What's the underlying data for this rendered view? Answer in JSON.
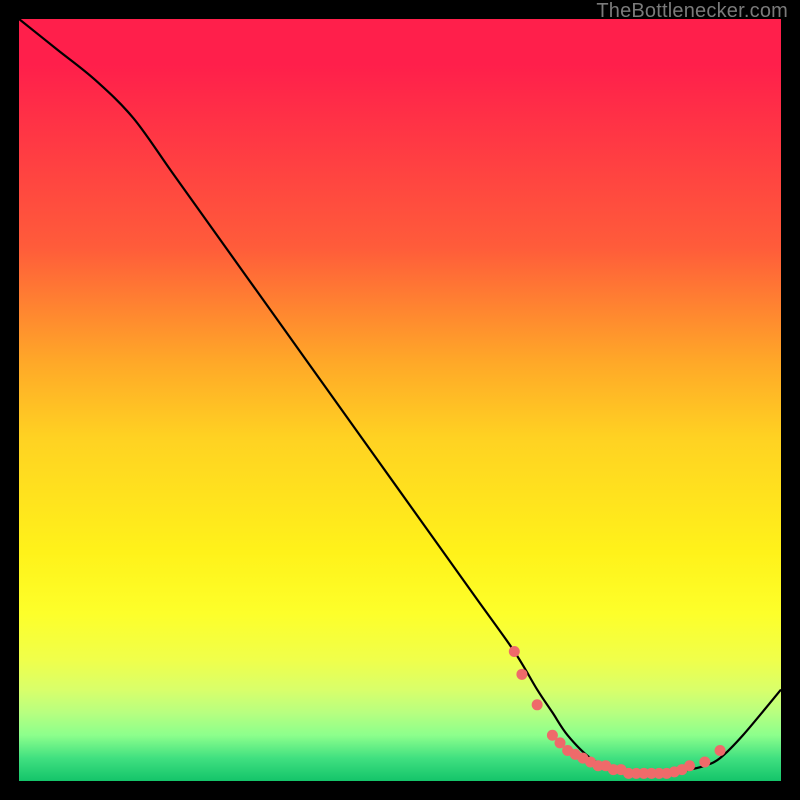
{
  "attribution": "TheBottlenecker.com",
  "chart_data": {
    "type": "line",
    "title": "",
    "xlabel": "",
    "ylabel": "",
    "xlim": [
      0,
      100
    ],
    "ylim": [
      0,
      100
    ],
    "series": [
      {
        "name": "bottleneck-curve",
        "x": [
          0,
          5,
          10,
          15,
          20,
          25,
          30,
          35,
          40,
          45,
          50,
          55,
          60,
          65,
          68,
          70,
          72,
          75,
          78,
          80,
          82,
          85,
          88,
          90,
          92,
          95,
          100
        ],
        "y": [
          100,
          96,
          92,
          87,
          80,
          73,
          66,
          59,
          52,
          45,
          38,
          31,
          24,
          17,
          12,
          9,
          6,
          3,
          1.5,
          1,
          1,
          1,
          1.5,
          2,
          3,
          6,
          12
        ]
      }
    ],
    "markers": {
      "name": "scatter-points",
      "color": "#ef6a6a",
      "x": [
        65,
        66,
        68,
        70,
        71,
        72,
        73,
        74,
        75,
        76,
        77,
        78,
        79,
        80,
        81,
        82,
        83,
        84,
        85,
        86,
        87,
        88,
        90,
        92
      ],
      "y": [
        17,
        14,
        10,
        6,
        5,
        4,
        3.5,
        3,
        2.5,
        2,
        2,
        1.5,
        1.5,
        1,
        1,
        1,
        1,
        1,
        1,
        1.2,
        1.5,
        2,
        2.5,
        4
      ]
    }
  }
}
